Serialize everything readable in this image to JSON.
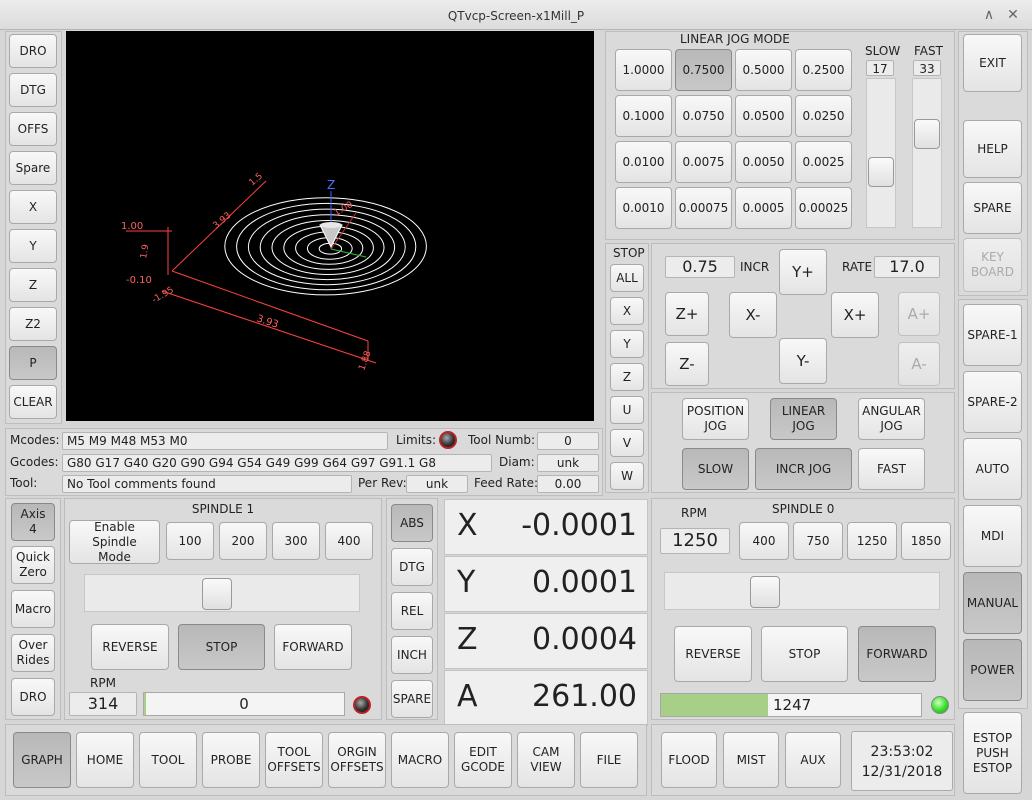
{
  "window": {
    "title": "QTvcp-Screen-x1Mill_P",
    "minimize": "∧",
    "close": "✕"
  },
  "left_nav": [
    "DRO",
    "DTG",
    "OFFS",
    "Spare",
    "X",
    "Y",
    "Z",
    "Z2",
    "P",
    "CLEAR"
  ],
  "right_nav": {
    "exit": "EXIT",
    "help": "HELP",
    "spare": "SPARE",
    "keyboard": "KEY\nBOARD",
    "spare1": "SPARE-1",
    "spare2": "SPARE-2",
    "auto": "AUTO",
    "mdi": "MDI",
    "manual": "MANUAL",
    "power": "POWER",
    "estop": "ESTOP\nPUSH\nESTOP"
  },
  "jog": {
    "mode_title": "LINEAR  JOG  MODE",
    "increments": [
      "1.0000",
      "0.7500",
      "0.5000",
      "0.2500",
      "0.1000",
      "0.0750",
      "0.0500",
      "0.0250",
      "0.0100",
      "0.0075",
      "0.0050",
      "0.0025",
      "0.0010",
      "0.00075",
      "0.0005",
      "0.00025"
    ],
    "slow_label": "SLOW",
    "slow_value": "17",
    "fast_label": "FAST",
    "fast_value": "33",
    "stop_label": "STOP",
    "stop_buttons": [
      "ALL",
      "X",
      "Y",
      "Z",
      "U",
      "V",
      "W"
    ],
    "incr_value": "0.75",
    "incr_label": "INCR",
    "rate_label": "RATE",
    "rate_value": "17.0",
    "axis_buttons": {
      "yplus": "Y+",
      "yminus": "Y-",
      "xplus": "X+",
      "xminus": "X-",
      "zplus": "Z+",
      "zminus": "Z-",
      "aplus": "A+",
      "aminus": "A-"
    },
    "mode_buttons": {
      "position": "POSITION\nJOG",
      "linear": "LINEAR\nJOG",
      "angular": "ANGULAR\nJOG",
      "slow": "SLOW",
      "incr": "INCR JOG",
      "fast": "FAST"
    }
  },
  "graph": {
    "axis_z": "Z",
    "labels": [
      "1.00",
      "-0.10",
      "1.9",
      "1.5",
      "3.93",
      "1.88",
      "3.93",
      "-1.95",
      "1.00"
    ]
  },
  "status": {
    "mcodes_label": "Mcodes:",
    "mcodes": "M5 M9 M48 M53 M0",
    "limits_label": "Limits:",
    "tool_numb_label": "Tool Numb:",
    "tool_numb": "0",
    "gcodes_label": "Gcodes:",
    "gcodes": "G80 G17 G40 G20 G90 G94 G54 G49 G99 G64 G97 G91.1 G8",
    "diam_label": "Diam:",
    "diam": "unk",
    "tool_label": "Tool:",
    "tool": "No Tool comments found",
    "per_rev_label": "Per Rev:",
    "per_rev": "unk",
    "feed_rate_label": "Feed Rate:",
    "feed_rate": "0.00"
  },
  "left_tools": [
    "Axis\n4",
    "Quick\nZero",
    "Macro",
    "Over\nRides",
    "DRO"
  ],
  "spindle1": {
    "title": "SPINDLE 1",
    "enable": "Enable Spindle\nMode",
    "presets": [
      "100",
      "200",
      "300",
      "400"
    ],
    "reverse": "REVERSE",
    "stop": "STOP",
    "forward": "FORWARD",
    "rpm_label": "RPM",
    "rpm": "314",
    "bar_value": "0",
    "slider_level": 0.48
  },
  "dro_buttons": [
    "ABS",
    "DTG",
    "REL",
    "INCH",
    "SPARE"
  ],
  "dro": [
    {
      "axis": "X",
      "value": "-0.0001"
    },
    {
      "axis": "Y",
      "value": "0.0001"
    },
    {
      "axis": "Z",
      "value": "0.0004"
    },
    {
      "axis": "A",
      "value": "261.00"
    }
  ],
  "spindle0": {
    "rpm_label": "RPM",
    "rpm": "1250",
    "title": "SPINDLE 0",
    "presets": [
      "400",
      "750",
      "1250",
      "1850"
    ],
    "reverse": "REVERSE",
    "stop": "STOP",
    "forward": "FORWARD",
    "bar_value": "1247",
    "bar_fraction": 0.41,
    "slider_level": 0.35
  },
  "bottom_tabs": [
    "GRAPH",
    "HOME",
    "TOOL",
    "PROBE",
    "TOOL\nOFFSETS",
    "ORGIN\nOFFSETS",
    "MACRO",
    "EDIT\nGCODE",
    "CAM\nVIEW",
    "FILE"
  ],
  "coolant": [
    "FLOOD",
    "MIST",
    "AUX"
  ],
  "clock": {
    "time": "23:53:02",
    "date": "12/31/2018"
  }
}
